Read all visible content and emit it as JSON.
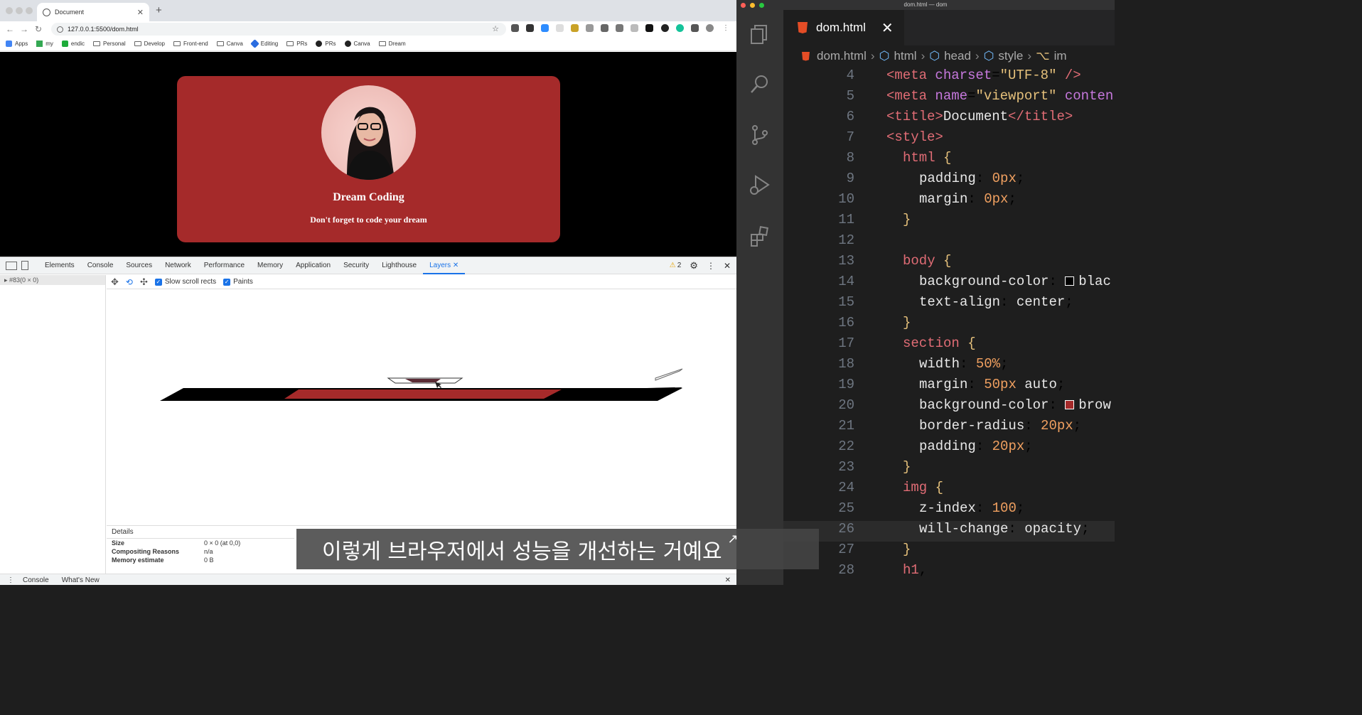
{
  "browser": {
    "tab_title": "Document",
    "url": "127.0.0.1:5500/dom.html",
    "bookmarks": [
      "Apps",
      "my",
      "endic",
      "Personal",
      "Develop",
      "Front-end",
      "Canva",
      "Editing",
      "PRs",
      "PRs",
      "Canva",
      "Dream"
    ]
  },
  "page": {
    "heading": "Dream Coding",
    "subheading": "Don't forget to code your dream"
  },
  "devtools": {
    "tabs": [
      "Elements",
      "Console",
      "Sources",
      "Network",
      "Performance",
      "Memory",
      "Application",
      "Security",
      "Lighthouse",
      "Layers"
    ],
    "active_tab": "Layers",
    "warnings": "2",
    "layer_item": "#83(0 × 0)",
    "options": {
      "slow_scroll": "Slow scroll rects",
      "paints": "Paints"
    },
    "details": {
      "title": "Details",
      "rows": [
        {
          "k": "Size",
          "v": "0 × 0 (at 0,0)"
        },
        {
          "k": "Compositing Reasons",
          "v": "n/a"
        },
        {
          "k": "Memory estimate",
          "v": "0 B"
        }
      ]
    },
    "drawer": [
      "Console",
      "What's New"
    ]
  },
  "vscode": {
    "window_title": "dom.html — dom",
    "tab": "dom.html",
    "breadcrumb": [
      "dom.html",
      "html",
      "head",
      "style",
      "im"
    ]
  },
  "subtitle": "이렇게 브라우저에서 성능을 개선하는 거예요"
}
